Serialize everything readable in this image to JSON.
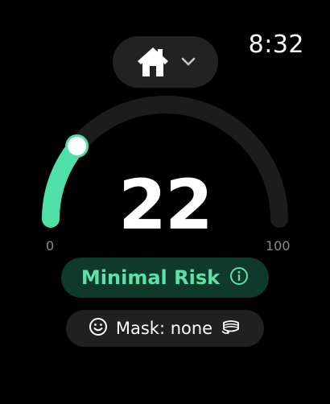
{
  "status_bar": {
    "time": "8:32"
  },
  "location": {
    "icon": "home-icon",
    "dropdown_icon": "chevron-down-icon"
  },
  "gauge": {
    "value": 22,
    "value_text": "22",
    "min": 0,
    "max": 100,
    "min_label": "0",
    "max_label": "100",
    "track_color": "#1c1c1c",
    "fill_color": "#4fe0a8",
    "knob_color": "#ffffff"
  },
  "risk": {
    "label": "Minimal Risk",
    "color": "#5ee0a8",
    "background": "#0f3a2b",
    "info_icon": "info-icon"
  },
  "mask": {
    "label": "Mask: none",
    "face_icon": "smiley-face-icon",
    "mask_icon": "face-mask-icon"
  }
}
